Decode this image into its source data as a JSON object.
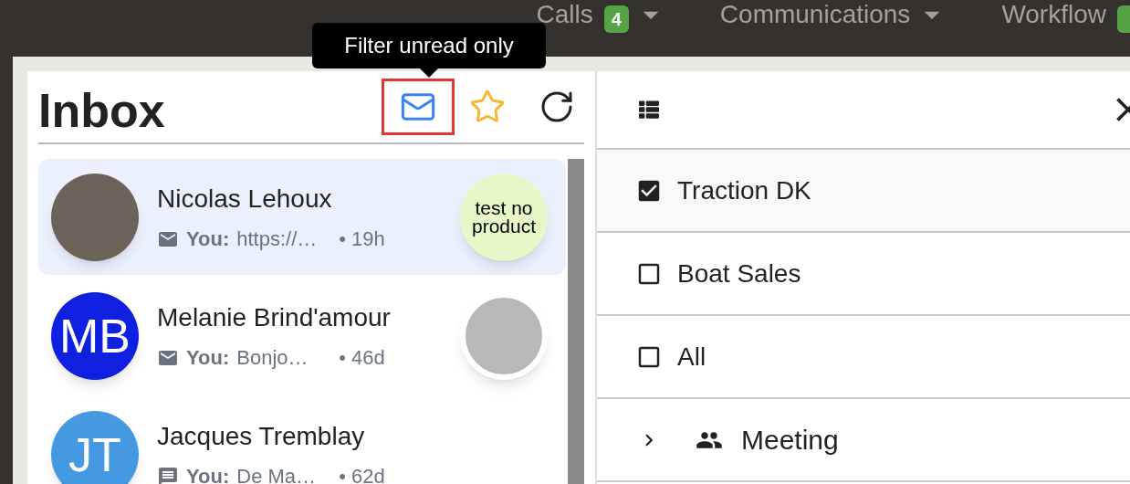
{
  "top_nav": [
    {
      "label": "Calls",
      "badge": "4",
      "dropdown": true
    },
    {
      "label": "Communications",
      "dropdown": true
    },
    {
      "label": "Workflow",
      "badge_cut": true
    }
  ],
  "tooltip": "Filter unread only",
  "inbox": {
    "title": "Inbox",
    "actions": [
      {
        "kind": "unread",
        "highlighted": true
      },
      {
        "kind": "starred",
        "highlighted": false
      },
      {
        "kind": "refresh",
        "highlighted": false
      }
    ],
    "conversations": [
      {
        "name": "Nicolas Lehoux",
        "avatar": {
          "kind": "photo"
        },
        "preview_icon": {
          "kind": "mail"
        },
        "sender": "You:",
        "preview": "https://…",
        "time": "• 19h",
        "thumbnail": {
          "kind": "text",
          "text": "test no product"
        },
        "selected": true
      },
      {
        "name": "Melanie Brind'amour",
        "avatar": {
          "kind": "initials",
          "initials": "MB",
          "color": "#1020e0"
        },
        "preview_icon": {
          "kind": "mail"
        },
        "sender": "You:",
        "preview": "Bonjo…",
        "time": "• 46d",
        "thumbnail": {
          "kind": "photo"
        },
        "selected": false
      },
      {
        "name": "Jacques Tremblay",
        "avatar": {
          "kind": "initials",
          "initials": "JT",
          "color": "#4499e0"
        },
        "preview_icon": {
          "kind": "chat"
        },
        "sender": "You:",
        "preview": "De Ma…",
        "time": "• 62d",
        "selected": false
      }
    ]
  },
  "filter_panel": {
    "items": [
      {
        "kind": "checkbox",
        "label": "Traction DK",
        "checked": true
      },
      {
        "kind": "checkbox",
        "label": "Boat Sales",
        "checked": false
      },
      {
        "kind": "checkbox",
        "label": "All",
        "checked": false
      },
      {
        "kind": "group",
        "label": "Meeting",
        "expanded": false
      }
    ]
  }
}
